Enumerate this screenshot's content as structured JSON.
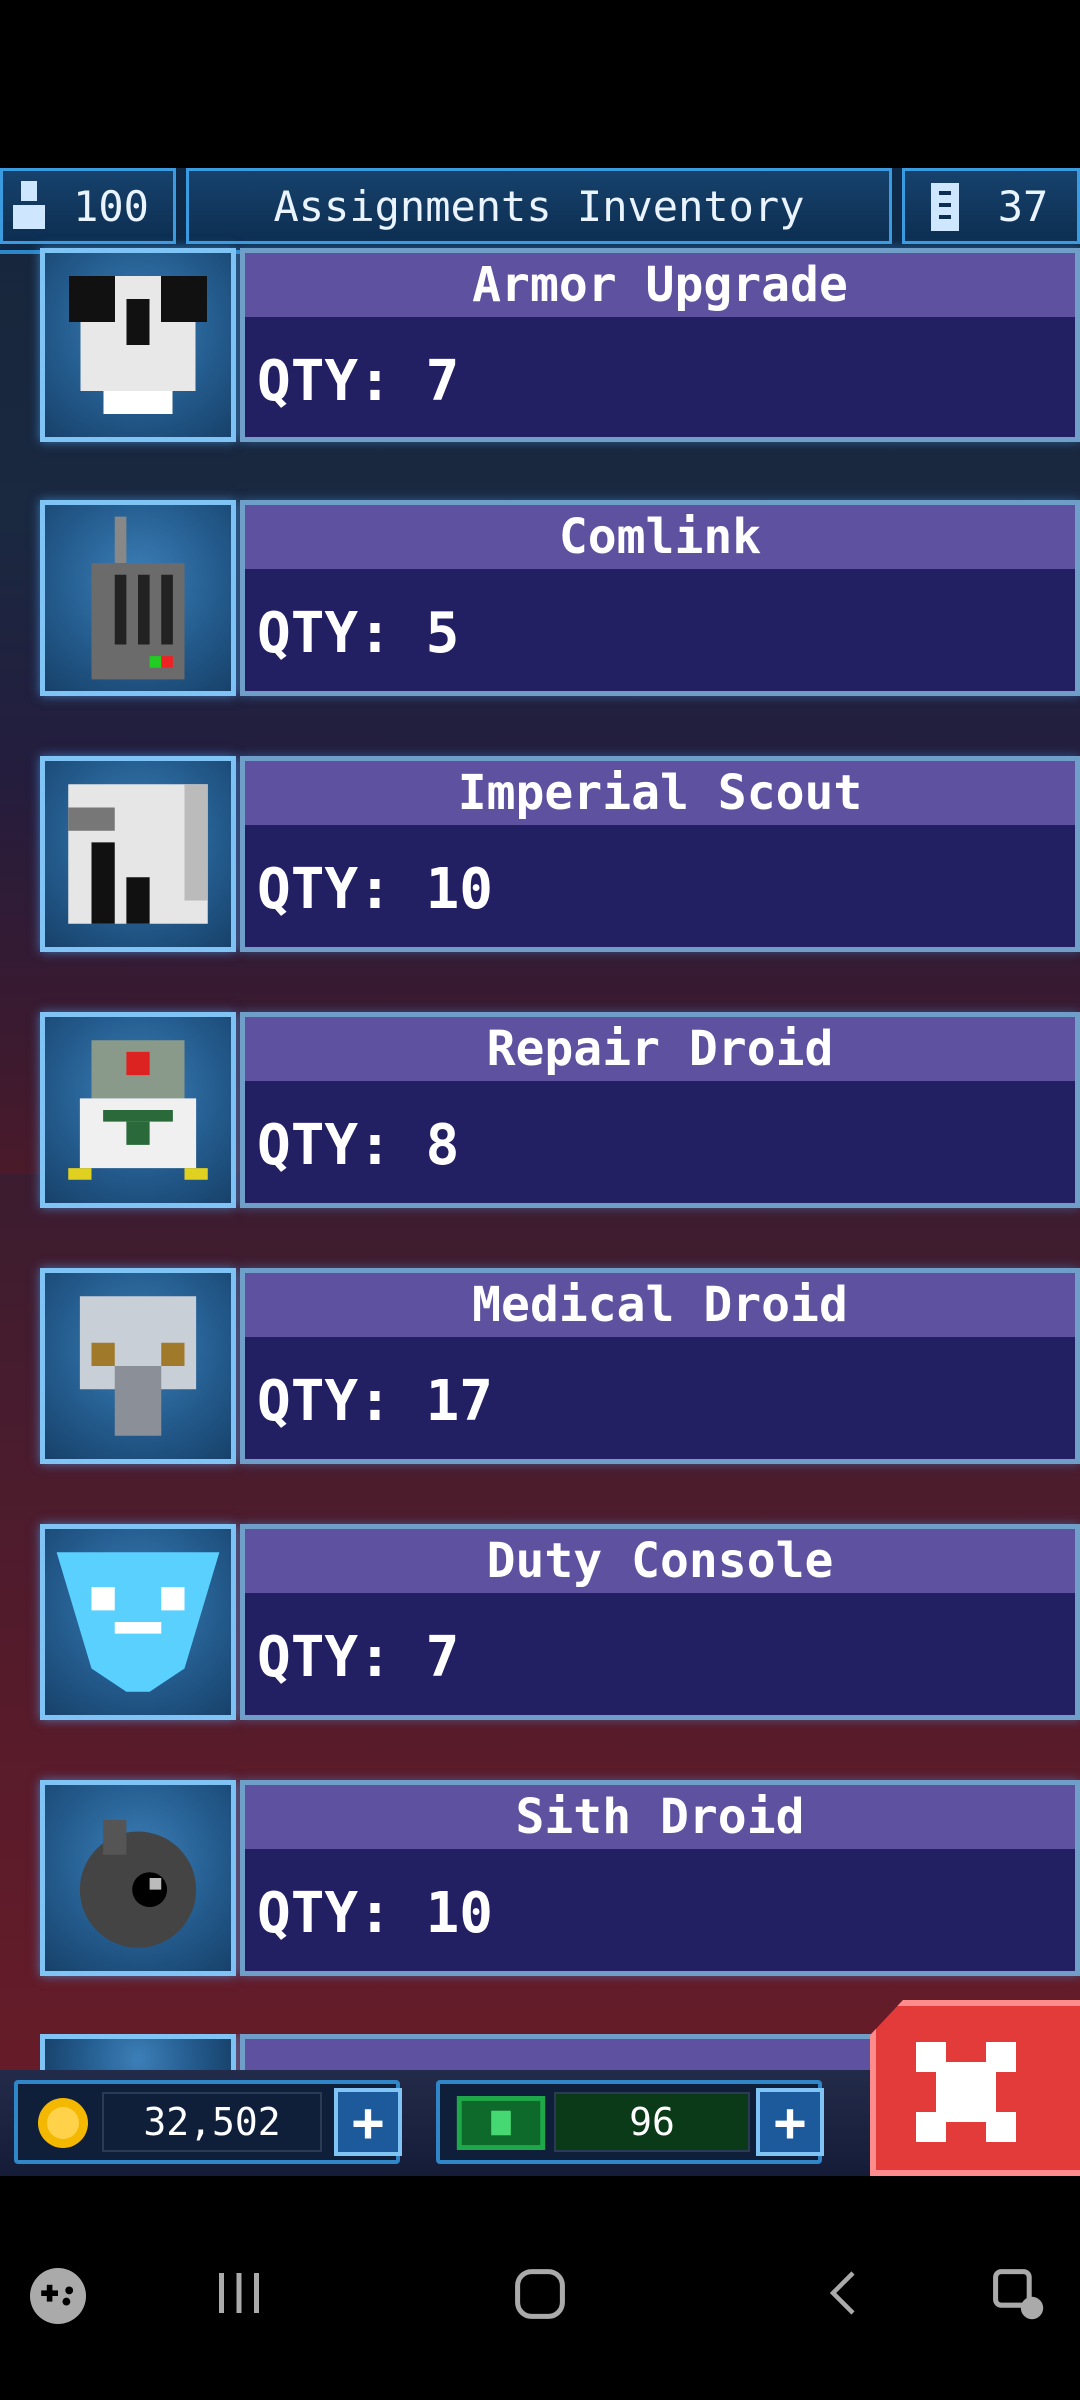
{
  "top_bar": {
    "crew_count": "100",
    "title": "Assignments Inventory",
    "level_count": "37"
  },
  "items": [
    {
      "name": "Armor Upgrade",
      "qty_label": "QTY: 7"
    },
    {
      "name": "Comlink",
      "qty_label": "QTY: 5"
    },
    {
      "name": "Imperial Scout",
      "qty_label": "QTY: 10"
    },
    {
      "name": "Repair Droid",
      "qty_label": "QTY: 8"
    },
    {
      "name": "Medical Droid",
      "qty_label": "QTY: 17"
    },
    {
      "name": "Duty Console",
      "qty_label": "QTY: 7"
    },
    {
      "name": "Sith Droid",
      "qty_label": "QTY: 10"
    }
  ],
  "currency": {
    "coins": "32,502",
    "bux": "96"
  },
  "colors": {
    "accent": "#3a9be0",
    "panel": "#221f63",
    "title_bar": "#5e52a0",
    "close": "#e33a3a"
  }
}
